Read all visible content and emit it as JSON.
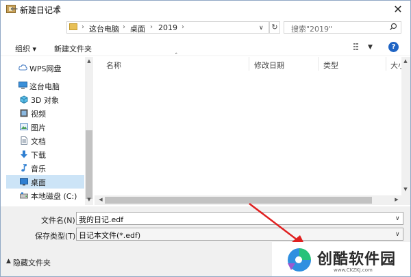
{
  "window": {
    "title": "新建日记本",
    "close_label": "✕"
  },
  "nav": {
    "breadcrumbs": [
      "这台电脑",
      "桌面",
      "2019"
    ],
    "search_placeholder": "搜索\"2019\""
  },
  "toolbar": {
    "organize": "组织 ▾",
    "new_folder": "新建文件夹",
    "help": "?"
  },
  "sidebar": {
    "items": [
      {
        "label": "WPS网盘",
        "icon": "cloud-icon"
      },
      {
        "label": "这台电脑",
        "icon": "computer-icon"
      },
      {
        "label": "3D 对象",
        "icon": "cube-icon"
      },
      {
        "label": "视频",
        "icon": "video-icon"
      },
      {
        "label": "图片",
        "icon": "picture-icon"
      },
      {
        "label": "文档",
        "icon": "document-icon"
      },
      {
        "label": "下载",
        "icon": "download-icon"
      },
      {
        "label": "音乐",
        "icon": "music-icon"
      },
      {
        "label": "桌面",
        "icon": "desktop-icon",
        "selected": true
      },
      {
        "label": "本地磁盘 (C:)",
        "icon": "drive-icon"
      }
    ]
  },
  "columns": [
    "名称",
    "修改日期",
    "类型",
    "大小"
  ],
  "form": {
    "filename_label": "文件名(N):",
    "filename_value": "我的日记.edf",
    "filetype_label": "保存类型(T):",
    "filetype_value": "日记本文件(*.edf)"
  },
  "footer": {
    "hide_folders": "隐藏文件夹"
  },
  "watermark": {
    "brand": "创酷软件园",
    "url": "www.CKZKJ.com"
  },
  "colors": {
    "selected_bg": "#cce4f7",
    "help_blue": "#1f64c4",
    "annotation_red": "#e02020"
  }
}
